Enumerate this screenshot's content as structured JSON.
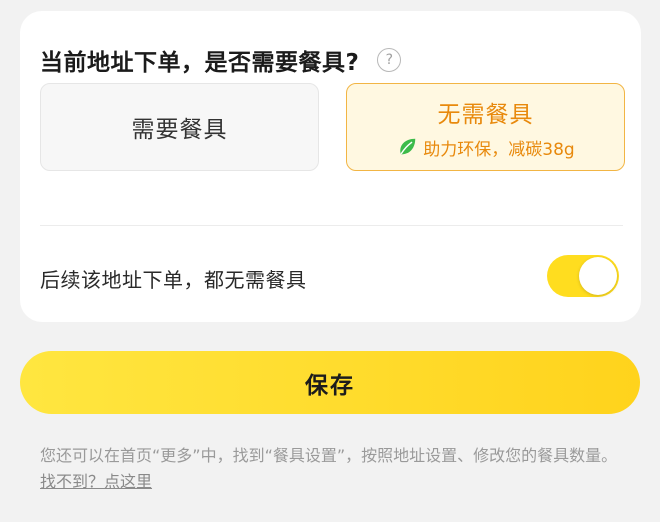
{
  "question": {
    "title": "当前地址下单，是否需要餐具?",
    "help_icon_glyph": "?"
  },
  "options": {
    "need": {
      "label": "需要餐具",
      "selected": false
    },
    "none": {
      "label": "无需餐具",
      "eco_text": "助力环保，减碳38g",
      "selected": true,
      "icon": "leaf-icon"
    }
  },
  "remember": {
    "label": "后续该地址下单，都无需餐具",
    "toggle_on": true
  },
  "save_button": {
    "label": "保存"
  },
  "footer": {
    "text": "您还可以在首页“更多”中，找到“餐具设置”，按照地址设置、修改您的餐具数量。",
    "link": "找不到？点这里"
  },
  "colors": {
    "accent_yellow": "#ffdd1f",
    "selected_orange": "#e8890c",
    "selected_border": "#f2b544",
    "leaf_green": "#3dbb4a"
  }
}
